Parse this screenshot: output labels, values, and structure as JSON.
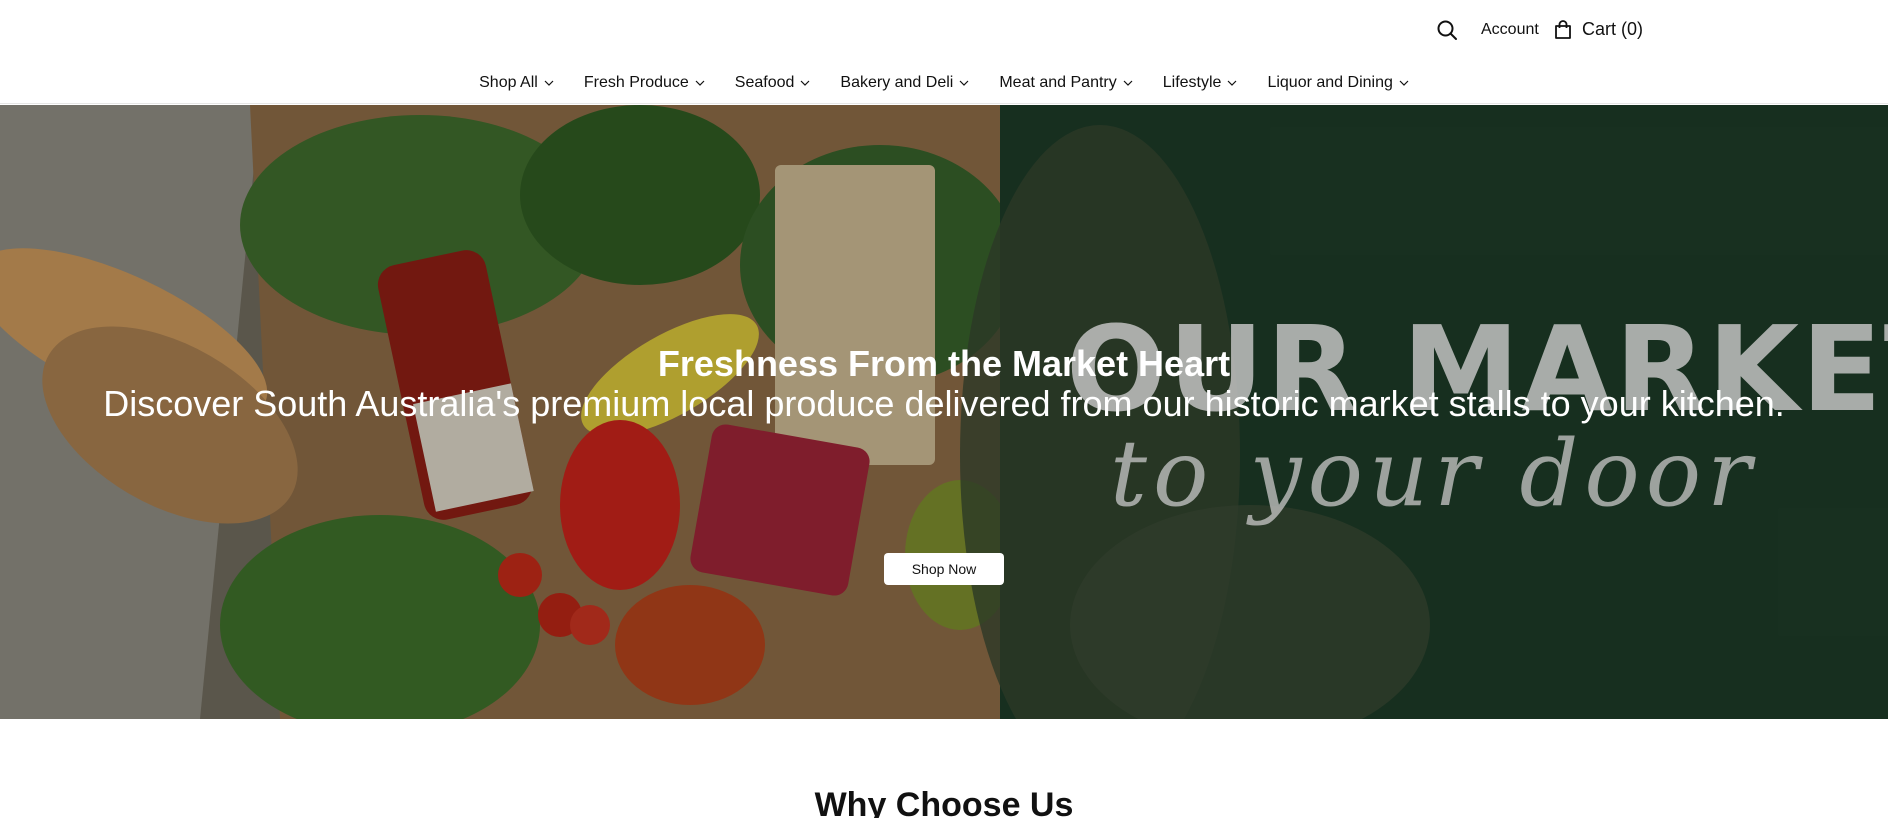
{
  "header": {
    "search_icon": "search-icon",
    "account_label": "Account",
    "cart_icon": "shopping-bag-icon",
    "cart_label": "Cart (0)"
  },
  "nav": {
    "items": [
      {
        "label": "Shop All"
      },
      {
        "label": "Fresh Produce"
      },
      {
        "label": "Seafood"
      },
      {
        "label": "Bakery and Deli"
      },
      {
        "label": "Meat and Pantry"
      },
      {
        "label": "Lifestyle"
      },
      {
        "label": "Liquor and Dining"
      }
    ]
  },
  "hero": {
    "title": "Freshness From the Market Heart",
    "subtitle": "Discover South Australia's premium local produce delivered from our historic market stalls to your kitchen.",
    "button_label": "Shop Now",
    "image_text_line1": "OUR MARKET",
    "image_text_line2": "to your door",
    "accent_color": "#1c3826"
  },
  "section": {
    "title": "Why Choose Us"
  }
}
